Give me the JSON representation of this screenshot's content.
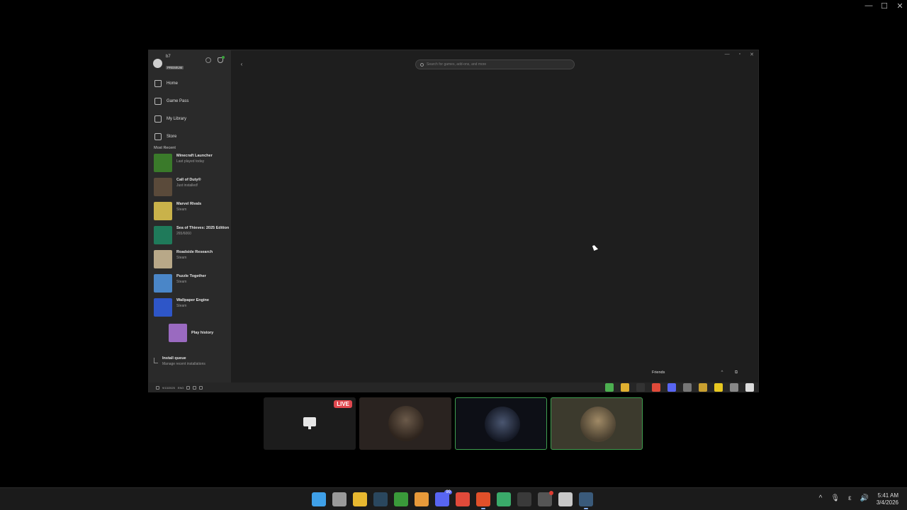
{
  "outer_window": {
    "minimize": "—",
    "maximize": "☐",
    "close": "✕"
  },
  "xbox": {
    "profile": {
      "username": "b7",
      "badge": "PREMIUM"
    },
    "nav": [
      {
        "label": "Home",
        "icon": "home-icon"
      },
      {
        "label": "Game Pass",
        "icon": "game-pass-icon"
      },
      {
        "label": "My Library",
        "icon": "library-icon"
      },
      {
        "label": "Store",
        "icon": "store-icon"
      }
    ],
    "recent_heading": "Most Recent",
    "recent": [
      {
        "title": "Minecraft Launcher",
        "sub": "Last played today",
        "color": "#3a7a2a"
      },
      {
        "title": "Call of Duty®",
        "sub": "Just installed!",
        "color": "#5a4a3a"
      },
      {
        "title": "Marvel Rivals",
        "sub": "Steam",
        "color": "#c9b24a"
      },
      {
        "title": "Sea of Thieves: 2025 Edition",
        "sub": "265/6060",
        "color": "#1f7a5a"
      },
      {
        "title": "Roadside Research",
        "sub": "Steam",
        "color": "#b8a888"
      },
      {
        "title": "Puzzle Together",
        "sub": "Steam",
        "color": "#4a86c8"
      },
      {
        "title": "Wallpaper Engine",
        "sub": "Steam",
        "color": "#2e56c8"
      }
    ],
    "play_history": {
      "label": "Play history",
      "color": "#9a6ac0"
    },
    "install_queue": {
      "title": "Install queue",
      "sub": "Manage recent installations"
    },
    "search_placeholder": "Search for games, add-ons, and more",
    "back": "‹",
    "window_controls": {
      "minimize": "—",
      "maximize": "▫",
      "close": "✕"
    },
    "friends": {
      "label": "Friends",
      "collapse": "^",
      "popout": "⧉"
    },
    "inner_tray": {
      "lang": "ENG",
      "clock": "9/13/2025"
    },
    "inner_apps": [
      {
        "name": "xbox-app-icon",
        "color": "#4caf50"
      },
      {
        "name": "folder-app-icon",
        "color": "#e0b030"
      },
      {
        "name": "epic-app-icon",
        "color": "#333333"
      },
      {
        "name": "chrome-app-icon",
        "color": "#e04a3a"
      },
      {
        "name": "discord-app-icon",
        "color": "#5865f2"
      },
      {
        "name": "notepad-app-icon",
        "color": "#777777"
      },
      {
        "name": "files-app-icon",
        "color": "#c9a030"
      },
      {
        "name": "sticky-app-icon",
        "color": "#e8c820"
      },
      {
        "name": "search-app-icon",
        "color": "#888888"
      },
      {
        "name": "start-app-icon",
        "color": "#dddddd"
      }
    ]
  },
  "call": {
    "live_badge": "LIVE"
  },
  "taskbar": {
    "apps": [
      {
        "name": "start-button-icon",
        "color": "#3fa0e8",
        "active": false
      },
      {
        "name": "settings-app-icon",
        "color": "#9a9a9a",
        "active": false
      },
      {
        "name": "file-explorer-app-icon",
        "color": "#e8b830",
        "active": false
      },
      {
        "name": "steam-app-icon",
        "color": "#2a475e",
        "active": false
      },
      {
        "name": "xbox-app-icon",
        "color": "#3a9a3a",
        "active": false
      },
      {
        "name": "affinity-app-icon",
        "color": "#e89a3a",
        "active": false
      },
      {
        "name": "discord-app-icon",
        "color": "#5865f2",
        "active": false,
        "badge": "99"
      },
      {
        "name": "chrome-app-icon",
        "color": "#e04a3a",
        "active": false
      },
      {
        "name": "brave-app-icon",
        "color": "#e0502a",
        "active": true
      },
      {
        "name": "android-app-icon",
        "color": "#3aaa6a",
        "active": false
      },
      {
        "name": "epic-app-icon",
        "color": "#3a3a3a",
        "active": false
      },
      {
        "name": "github-app-icon",
        "color": "#555555",
        "active": false,
        "dot": true
      },
      {
        "name": "notepad-app-icon",
        "color": "#c8c8c8",
        "active": false
      },
      {
        "name": "steam-helper-app-icon",
        "color": "#3a5a7a",
        "active": true
      }
    ],
    "tray": {
      "chevron": "^",
      "mic": "🎙",
      "lang": "ε",
      "speaker": "🔊"
    },
    "time": "5:41 AM",
    "date": "3/4/2026"
  }
}
